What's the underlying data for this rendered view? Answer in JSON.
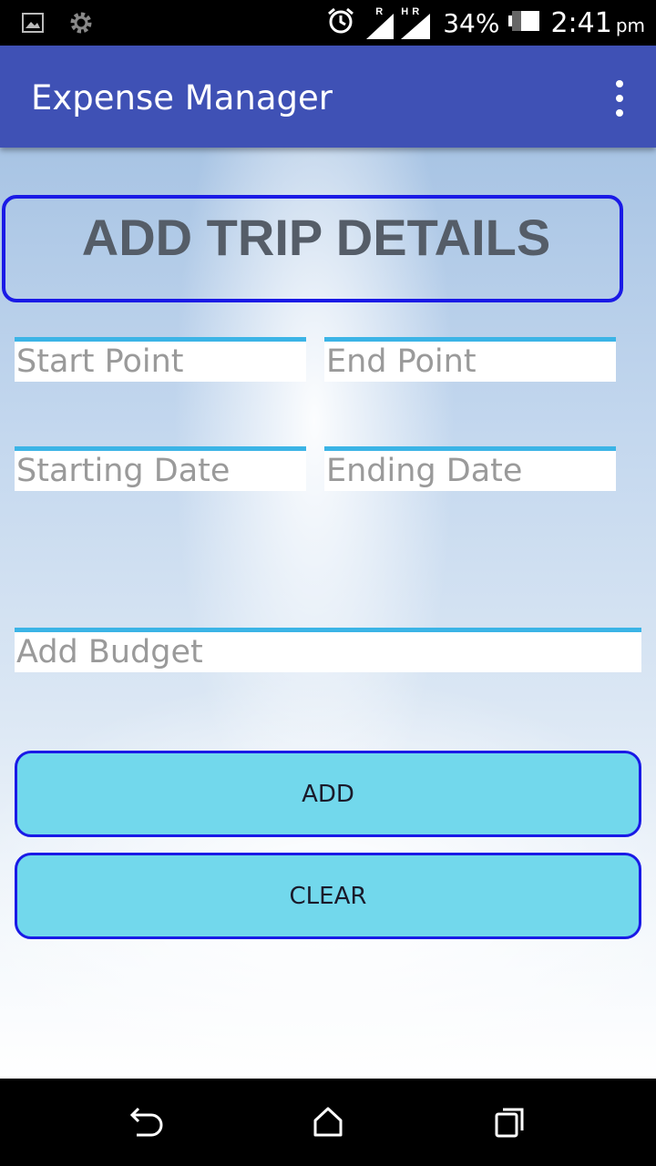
{
  "status_bar": {
    "signal_label_1": "R",
    "signal_label_2": "H",
    "signal_label_3": "R",
    "battery_percent": "34%",
    "time": "2:41",
    "ampm": "pm"
  },
  "app_bar": {
    "title": "Expense Manager"
  },
  "form": {
    "heading": "ADD TRIP DETAILS",
    "start_point_placeholder": "Start Point",
    "end_point_placeholder": "End Point",
    "starting_date_placeholder": "Starting Date",
    "ending_date_placeholder": "Ending Date",
    "budget_placeholder": "Add Budget",
    "add_label": "ADD",
    "clear_label": "CLEAR"
  },
  "colors": {
    "app_bar": "#3f51b5",
    "button_fill": "#72d8ec",
    "button_border": "#1a1ae6",
    "field_underline": "#3bb4e6"
  },
  "icons": {
    "status_left": [
      "image-icon",
      "gear-icon"
    ],
    "status_right": [
      "alarm-icon",
      "signal-icon",
      "battery-icon"
    ],
    "nav": [
      "back-icon",
      "home-icon",
      "recents-icon"
    ]
  }
}
